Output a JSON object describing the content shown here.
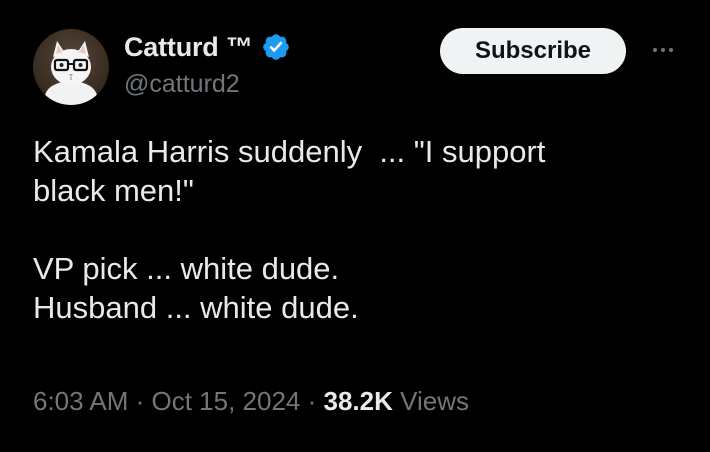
{
  "author": {
    "display_name": "Catturd ™",
    "handle": "@catturd2",
    "verified_icon": "verified-badge-icon",
    "avatar_icon": "cat-with-glasses-avatar"
  },
  "actions": {
    "subscribe_label": "Subscribe",
    "more_icon": "more-options-icon"
  },
  "tweet": {
    "lines": [
      "Kamala Harris suddenly  ... \"I support",
      "black men!\"",
      "",
      "VP pick ... white dude.",
      "Husband ... white dude."
    ]
  },
  "meta": {
    "time": "6:03 AM",
    "separator": " · ",
    "date": "Oct 15, 2024",
    "views_count": "38.2K",
    "views_label": " Views"
  },
  "colors": {
    "background": "#000000",
    "text_primary": "#e7e9ea",
    "text_secondary": "#71767b",
    "verified_blue": "#1d9bf0",
    "subscribe_bg": "#eff3f4"
  }
}
